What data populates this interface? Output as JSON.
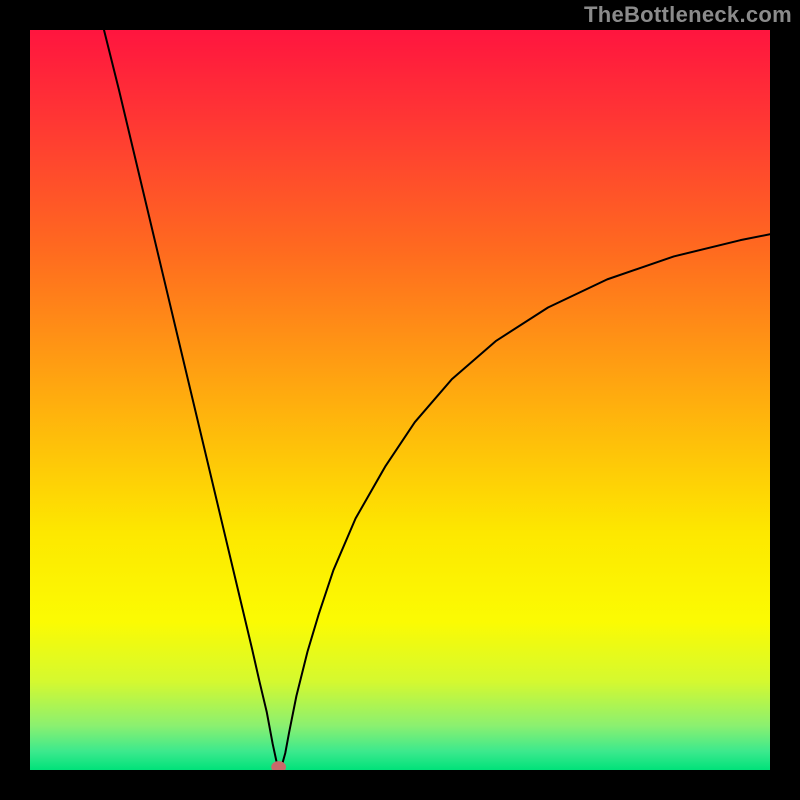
{
  "watermark": "TheBottleneck.com",
  "chart_data": {
    "type": "line",
    "title": "",
    "xlabel": "",
    "ylabel": "",
    "xlim": [
      0,
      100
    ],
    "ylim": [
      0,
      100
    ],
    "plot_bg_gradient": {
      "stops": [
        {
          "offset": 0.0,
          "color": "#ff153f"
        },
        {
          "offset": 0.12,
          "color": "#ff3634"
        },
        {
          "offset": 0.3,
          "color": "#ff6b1f"
        },
        {
          "offset": 0.5,
          "color": "#ffad0e"
        },
        {
          "offset": 0.68,
          "color": "#fde800"
        },
        {
          "offset": 0.8,
          "color": "#fbfb03"
        },
        {
          "offset": 0.88,
          "color": "#d5f92f"
        },
        {
          "offset": 0.94,
          "color": "#8bf070"
        },
        {
          "offset": 0.975,
          "color": "#3ce98d"
        },
        {
          "offset": 1.0,
          "color": "#00e27a"
        }
      ]
    },
    "series": [
      {
        "name": "bottleneck-curve",
        "color": "#000000",
        "stroke_width": 2,
        "x": [
          10.0,
          12.0,
          14.0,
          16.0,
          18.0,
          20.0,
          22.0,
          24.0,
          26.0,
          28.0,
          30.0,
          31.0,
          32.0,
          32.8,
          33.3,
          33.6,
          34.0,
          34.5,
          35.0,
          36.0,
          37.5,
          39.0,
          41.0,
          44.0,
          48.0,
          52.0,
          57.0,
          63.0,
          70.0,
          78.0,
          87.0,
          96.0,
          100.0
        ],
        "values": [
          100.0,
          92.0,
          83.6,
          75.2,
          66.8,
          58.4,
          50.0,
          41.6,
          33.2,
          24.8,
          16.4,
          12.0,
          7.8,
          3.5,
          1.2,
          0.2,
          0.5,
          2.3,
          5.0,
          10.0,
          16.0,
          21.0,
          27.0,
          34.0,
          41.0,
          47.0,
          52.8,
          58.0,
          62.5,
          66.3,
          69.4,
          71.6,
          72.4
        ]
      }
    ],
    "marker": {
      "name": "optimum-point",
      "x": 33.6,
      "y": 0.4,
      "rx": 1.0,
      "ry": 0.8,
      "color": "#c96a6a"
    }
  }
}
